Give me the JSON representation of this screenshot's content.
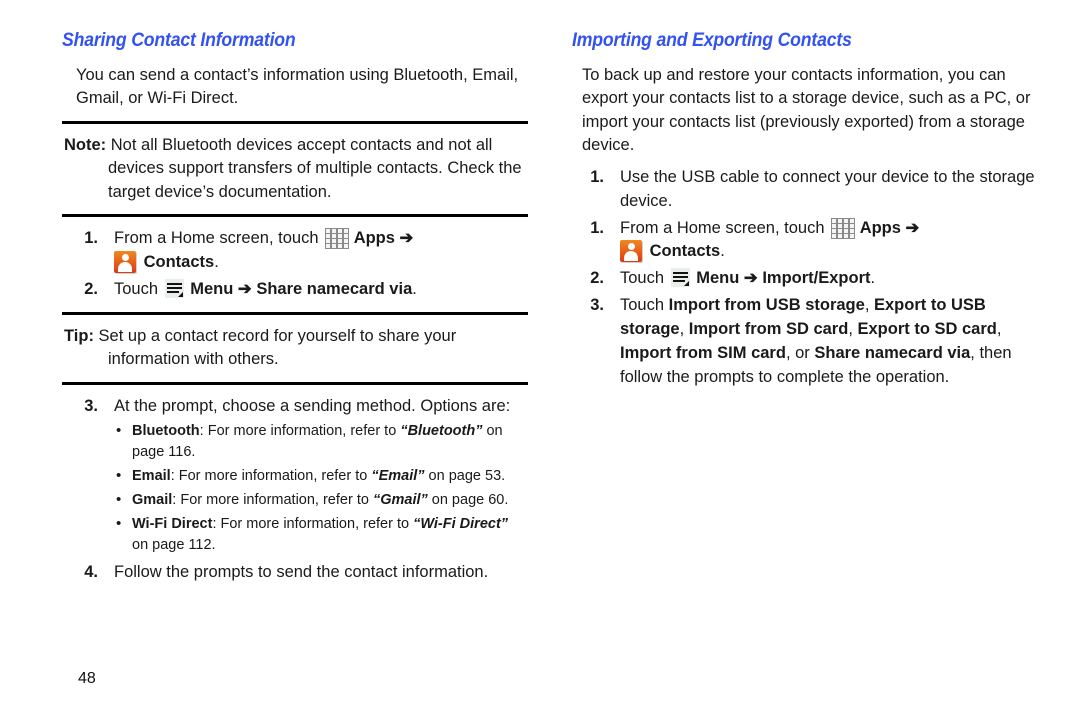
{
  "page": {
    "number": "48",
    "heading_color": "#3352ef",
    "rule_color": "#000000"
  },
  "icons": {
    "apps": "apps-grid-icon",
    "contacts": "contacts-person-icon",
    "menu": "menu-hamburger-icon",
    "arrow": "➔"
  },
  "left_column": {
    "heading": "Sharing Contact Information",
    "intro": "You can send a contact’s information using Bluetooth, Email, Gmail, or Wi-Fi Direct.",
    "note": {
      "label": "Note:",
      "text": "Not all Bluetooth devices accept contacts and not all devices support transfers of multiple contacts. Check the target device’s documentation."
    },
    "steps_a": [
      {
        "num": "1.",
        "pre": "From a Home screen, touch",
        "apps_label": "Apps",
        "contacts_label": "Contacts",
        "post": "."
      },
      {
        "num": "2.",
        "pre": "Touch",
        "menu_label": "Menu",
        "target": "Share namecard via",
        "post": "."
      }
    ],
    "tip": {
      "label": "Tip:",
      "text": "Set up a contact record for yourself to share your information with others."
    },
    "steps_b": [
      {
        "num": "3.",
        "text": "At the prompt, choose a sending method. Options are:"
      },
      {
        "num": "4.",
        "text": "Follow the prompts to send the contact information."
      }
    ],
    "bullets": [
      {
        "term": "Bluetooth",
        "mid": ": For more information, refer to ",
        "ref": "“Bluetooth”",
        "tail": " on page 116."
      },
      {
        "term": "Email",
        "mid": ": For more information, refer to ",
        "ref": "“Email”",
        "tail": " on page 53."
      },
      {
        "term": "Gmail",
        "mid": ": For more information, refer to ",
        "ref": "“Gmail”",
        "tail": " on page 60."
      },
      {
        "term": "Wi-Fi Direct",
        "mid": ": For more information, refer to ",
        "ref": "“Wi-Fi Direct”",
        "tail": " on page 112."
      }
    ]
  },
  "right_column": {
    "heading": "Importing and Exporting Contacts",
    "intro": "To back up and restore your contacts information, you can export your contacts list to a storage device, such as a PC, or import your contacts list (previously exported) from a storage device.",
    "steps": [
      {
        "num": "1.",
        "text": "Use the USB cable to connect your device to the storage device."
      },
      {
        "num": "1.",
        "pre": "From a Home screen, touch",
        "apps_label": "Apps",
        "contacts_label": "Contacts",
        "post": "."
      },
      {
        "num": "2.",
        "pre": "Touch",
        "menu_label": "Menu",
        "target": "Import/Export",
        "post": "."
      },
      {
        "num": "3.",
        "pre": "Touch ",
        "options": [
          "Import from USB storage",
          "Export to USB storage",
          "Import from SD card",
          "Export to SD card",
          "Import from SIM card",
          "Share namecard via"
        ],
        "conjunction": ", or ",
        "tail": ", then follow the prompts to complete the operation."
      }
    ]
  }
}
